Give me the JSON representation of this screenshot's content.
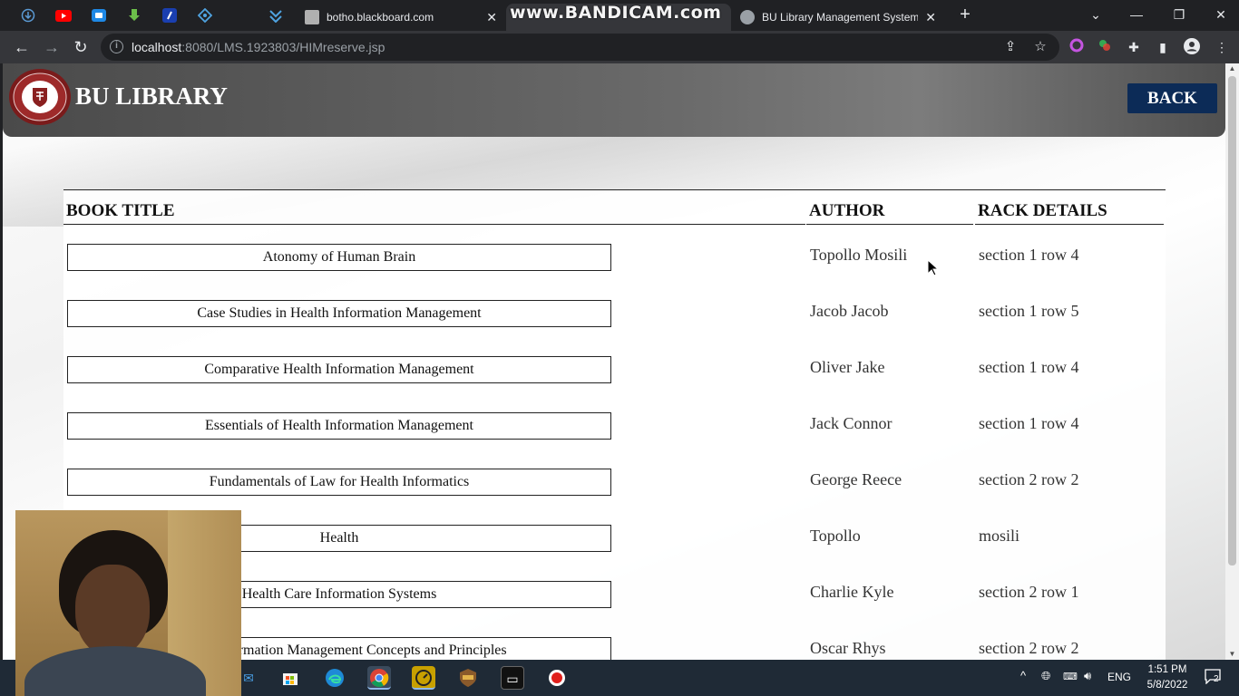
{
  "browser": {
    "tabs": [
      {
        "title": "botho.blackboard.com",
        "active": false
      },
      {
        "title": "",
        "active": true
      },
      {
        "title": "BU Library Management System",
        "active": false
      }
    ],
    "watermark": "www.BANDICAM.com",
    "address": {
      "host": "localhost",
      "path": ":8080/LMS.1923803/HIMreserve.jsp"
    }
  },
  "page": {
    "brand": "BU LIBRARY",
    "back_label": "BACK",
    "columns": {
      "title": "BOOK TITLE",
      "author": "AUTHOR",
      "rack": "RACK DETAILS"
    },
    "rows": [
      {
        "title": "Atonomy of Human Brain",
        "author": "Topollo Mosili",
        "rack": "section 1 row 4"
      },
      {
        "title": "Case Studies in Health Information Management",
        "author": "Jacob Jacob",
        "rack": "section 1 row 5"
      },
      {
        "title": "Comparative Health Information Management",
        "author": "Oliver Jake",
        "rack": "section 1 row 4"
      },
      {
        "title": "Essentials of Health Information Management",
        "author": "Jack Connor",
        "rack": "section 1 row 4"
      },
      {
        "title": "Fundamentals of Law for Health Informatics",
        "author": "George Reece",
        "rack": "section 2 row 2"
      },
      {
        "title": "Health",
        "author": "Topollo",
        "rack": "mosili"
      },
      {
        "title": "Health Care Information Systems",
        "author": "Charlie Kyle",
        "rack": "section 2 row 1"
      },
      {
        "title": "Health Information Management Concepts and Principles",
        "author": "Oscar Rhys",
        "rack": "section 2 row 2"
      }
    ]
  },
  "taskbar": {
    "lang": "ENG",
    "time": "1:51 PM",
    "date": "5/8/2022",
    "notifications": "2"
  },
  "colors": {
    "accent": "#0c2b57",
    "header": "#5a5a5a",
    "taskbar": "#1f2a36"
  }
}
